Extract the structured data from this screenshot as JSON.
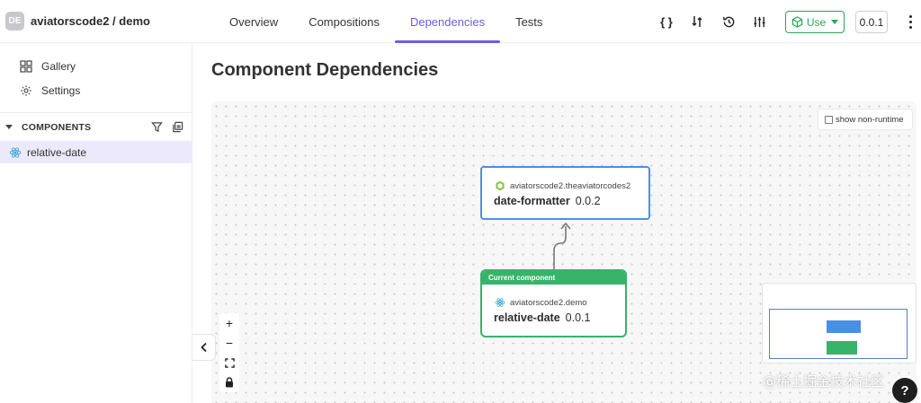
{
  "header": {
    "scope_avatar": "DE",
    "scope_name": "aviatorscode2 / demo",
    "tabs": [
      {
        "label": "Overview"
      },
      {
        "label": "Compositions"
      },
      {
        "label": "Dependencies"
      },
      {
        "label": "Tests"
      }
    ],
    "active_tab": "Dependencies",
    "tools": {
      "code_icon": "{ }",
      "compare_icon": "compare-icon",
      "history_icon": "history-icon",
      "settings_icon": "sliders-icon"
    },
    "use_label": "Use",
    "version": "0.0.1"
  },
  "sidebar": {
    "items": [
      {
        "label": "Gallery",
        "icon": "grid-icon"
      },
      {
        "label": "Settings",
        "icon": "gear-icon"
      }
    ],
    "components_title": "COMPONENTS",
    "components": [
      {
        "label": "relative-date",
        "icon": "react-icon"
      }
    ]
  },
  "main": {
    "title": "Component Dependencies",
    "show_non_runtime_label": "show non-runtime",
    "dependency_node": {
      "scope": "aviatorscode2.theaviatorcodes2",
      "name": "date-formatter",
      "version": "0.0.2"
    },
    "current_node": {
      "banner": "Current component",
      "scope": "aviatorscode2.demo",
      "name": "relative-date",
      "version": "0.0.1"
    }
  },
  "zoom": {
    "zoom_in": "+",
    "zoom_out": "−"
  },
  "watermark": "@稀土掘金技术社区",
  "help_label": "?",
  "colors": {
    "accent": "#6c5ce7",
    "use_green": "#26a65b",
    "dependency_border": "#4f8fe0",
    "current_green": "#37b36a"
  }
}
